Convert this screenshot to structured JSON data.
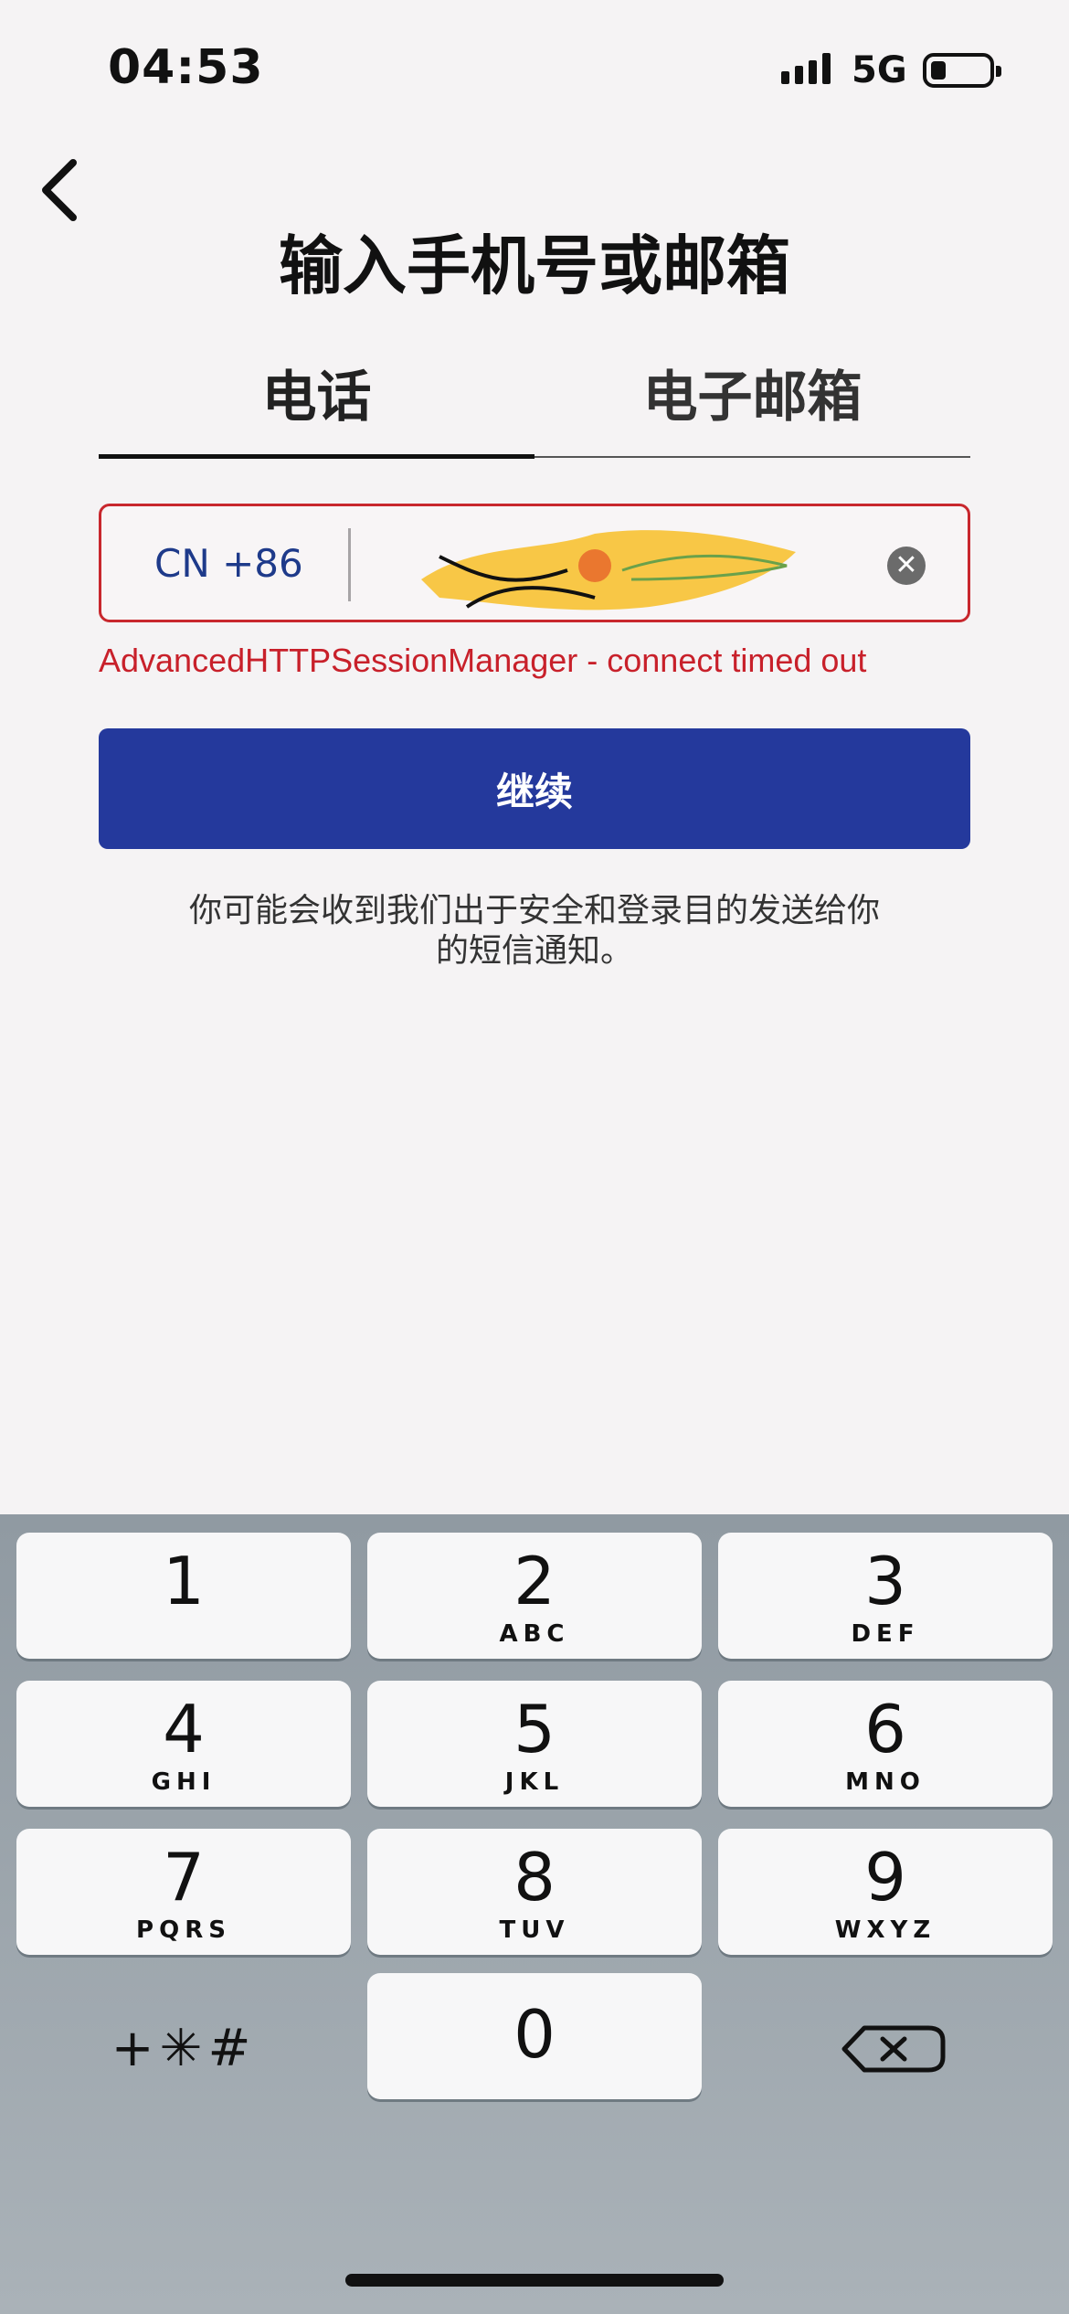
{
  "status_bar": {
    "time": "04:53",
    "network": "5G"
  },
  "header": {
    "title": "输入手机号或邮箱"
  },
  "tabs": [
    {
      "label": "电话",
      "active": true
    },
    {
      "label": "电子邮箱",
      "active": false
    }
  ],
  "phone_field": {
    "country_code": "CN +86",
    "value": ""
  },
  "error": {
    "message": "AdvancedHTTPSessionManager - connect timed out"
  },
  "continue_button": {
    "label": "继续"
  },
  "notice": {
    "line1": "你可能会收到我们出于安全和登录目的发送给你",
    "line2": "的短信通知。"
  },
  "keypad": {
    "keys": [
      {
        "digit": "1",
        "letters": ""
      },
      {
        "digit": "2",
        "letters": "ABC"
      },
      {
        "digit": "3",
        "letters": "DEF"
      },
      {
        "digit": "4",
        "letters": "GHI"
      },
      {
        "digit": "5",
        "letters": "JKL"
      },
      {
        "digit": "6",
        "letters": "MNO"
      },
      {
        "digit": "7",
        "letters": "PQRS"
      },
      {
        "digit": "8",
        "letters": "TUV"
      },
      {
        "digit": "9",
        "letters": "WXYZ"
      },
      {
        "digit": "0",
        "letters": ""
      }
    ],
    "symbols": "+✳#"
  },
  "colors": {
    "accent": "#24399c",
    "error": "#c8202a",
    "country_code": "#1e3a8a"
  }
}
